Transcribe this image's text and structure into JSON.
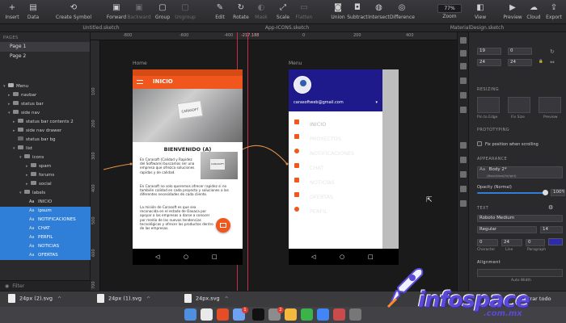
{
  "toolbar": {
    "items": [
      {
        "label": "Insert",
        "icon": "plus-icon"
      },
      {
        "label": "Data",
        "icon": "data-icon"
      },
      {
        "label": "Create Symbol",
        "icon": "symbol-icon"
      },
      {
        "label": "Forward",
        "icon": "forward-icon"
      },
      {
        "label": "Backward",
        "icon": "backward-icon"
      },
      {
        "label": "Group",
        "icon": "group-icon"
      },
      {
        "label": "Ungroup",
        "icon": "ungroup-icon"
      },
      {
        "label": "Edit",
        "icon": "edit-icon"
      },
      {
        "label": "Rotate",
        "icon": "rotate-icon"
      },
      {
        "label": "Mask",
        "icon": "mask-icon"
      },
      {
        "label": "Scale",
        "icon": "scale-icon"
      },
      {
        "label": "Flatten",
        "icon": "flatten-icon"
      },
      {
        "label": "Union",
        "icon": "union-icon"
      },
      {
        "label": "Subtract",
        "icon": "subtract-icon"
      },
      {
        "label": "Intersect",
        "icon": "intersect-icon"
      },
      {
        "label": "Difference",
        "icon": "difference-icon"
      },
      {
        "label": "Zoom",
        "icon": "zoom-icon"
      },
      {
        "label": "View",
        "icon": "view-icon"
      },
      {
        "label": "Preview",
        "icon": "preview-icon"
      },
      {
        "label": "Cloud",
        "icon": "cloud-icon"
      },
      {
        "label": "Export",
        "icon": "export-icon"
      }
    ],
    "zoom_value": "77%"
  },
  "tabs": [
    "Untitled.sketch",
    "App-ICONS.sketch",
    "MaterialDesign.sketch"
  ],
  "left_panel": {
    "pages_header": "PAGES",
    "pages": [
      "Page 1",
      "Page 2"
    ],
    "layers": [
      {
        "label": "Menu",
        "kind": "artboard"
      },
      {
        "label": "navbar",
        "kind": "folder"
      },
      {
        "label": "status bar",
        "kind": "folder"
      },
      {
        "label": "side nav",
        "kind": "folder"
      },
      {
        "label": "status bar contents 2",
        "kind": "folder"
      },
      {
        "label": "side nav drawer",
        "kind": "folder"
      },
      {
        "label": "status bar bg",
        "kind": "shape"
      },
      {
        "label": "list",
        "kind": "folder"
      },
      {
        "label": "icons",
        "kind": "folder"
      },
      {
        "label": "spam",
        "kind": "folder"
      },
      {
        "label": "forums",
        "kind": "folder"
      },
      {
        "label": "social",
        "kind": "folder"
      },
      {
        "label": "labels",
        "kind": "folder"
      },
      {
        "label": "INICIO",
        "kind": "text"
      },
      {
        "label": "ipsum",
        "kind": "text"
      },
      {
        "label": "NOTIFICACIONES",
        "kind": "text"
      },
      {
        "label": "CHAT",
        "kind": "text"
      },
      {
        "label": "PERFIL",
        "kind": "text"
      },
      {
        "label": "NOTICIAS",
        "kind": "text"
      },
      {
        "label": "OFERTAS",
        "kind": "text"
      }
    ],
    "filter_placeholder": "Filter"
  },
  "canvas": {
    "ruler_top": [
      "-800",
      "-600",
      "-400",
      "-217.188",
      "0",
      "200",
      "400"
    ],
    "ruler_left": [
      "100",
      "200",
      "300",
      "400",
      "500",
      "600",
      "700"
    ],
    "artboard1_label": "Home",
    "artboard2_label": "Menu",
    "home": {
      "title": "INICIO",
      "logo_text": "CARASOFT",
      "welcome": "BIENVENIDO (A)",
      "para1": "En Carasoft (Calidad y Rapidez del Software) buscamos ser una empresa que ofrezca soluciones rapidas y de calidad.",
      "para2": "En Carasoft no solo queremos ofrecer rapidez si no también calidad en cada proyecto y soluciones a las diferentes necesidades de cada cliente.",
      "para3": "La misión de Carasoft es que sea reconocida en el estado de Oaxaca por apoyar a las empresas a darse a conocer por medio de las nuevas tendencias tecnológicas y ofrecer los productos dentro de las empresas."
    },
    "menu": {
      "email": "carasoftweb@gmail.com",
      "items": [
        "INICIO",
        "PROYECTOS",
        "NOTIFICACIONES",
        "CHAT",
        "NOTICIAS",
        "OFERTAS",
        "PERFIL"
      ]
    }
  },
  "inspector": {
    "x": "19",
    "y": "0",
    "w": "24",
    "h": "24",
    "resizing_header": "RESIZING",
    "resize_labels": [
      "Pin to Edge",
      "Fix Size",
      "Preview"
    ],
    "prototyping_header": "PROTOTYPING",
    "fix_position": "Fix position when scrolling",
    "appearance_header": "APPEARANCE",
    "text_style": "Body 2*",
    "text_style_sub": "(Base/Ideal/ht/ight)",
    "opacity_label": "Opacity (Normal)",
    "opacity_value": "100%",
    "opacity": 1.0,
    "text_header": "TEXT",
    "font": "Roboto Medium",
    "weight": "Regular",
    "size": "14",
    "char_value": "0",
    "line_value": "24",
    "para_value": "0",
    "char_labels": [
      "Character",
      "Line",
      "Paragraph"
    ],
    "alignment_header": "Alignment",
    "auto_width": "Auto Width",
    "text_color": "#2b2ab0"
  },
  "downloads": {
    "files": [
      "24px (2).svg",
      "24px (1).svg",
      "24px.svg"
    ],
    "show_all": "Mostrar todo"
  },
  "dock_badges": [
    "1",
    "2"
  ],
  "watermark": {
    "text": "infospace",
    "sub": ".com.mx"
  },
  "colors": {
    "accent_orange": "#f1571c",
    "drawer_blue": "#1f1a8c",
    "selection_blue": "#2f7fd9",
    "guide_red": "#c0304a"
  }
}
